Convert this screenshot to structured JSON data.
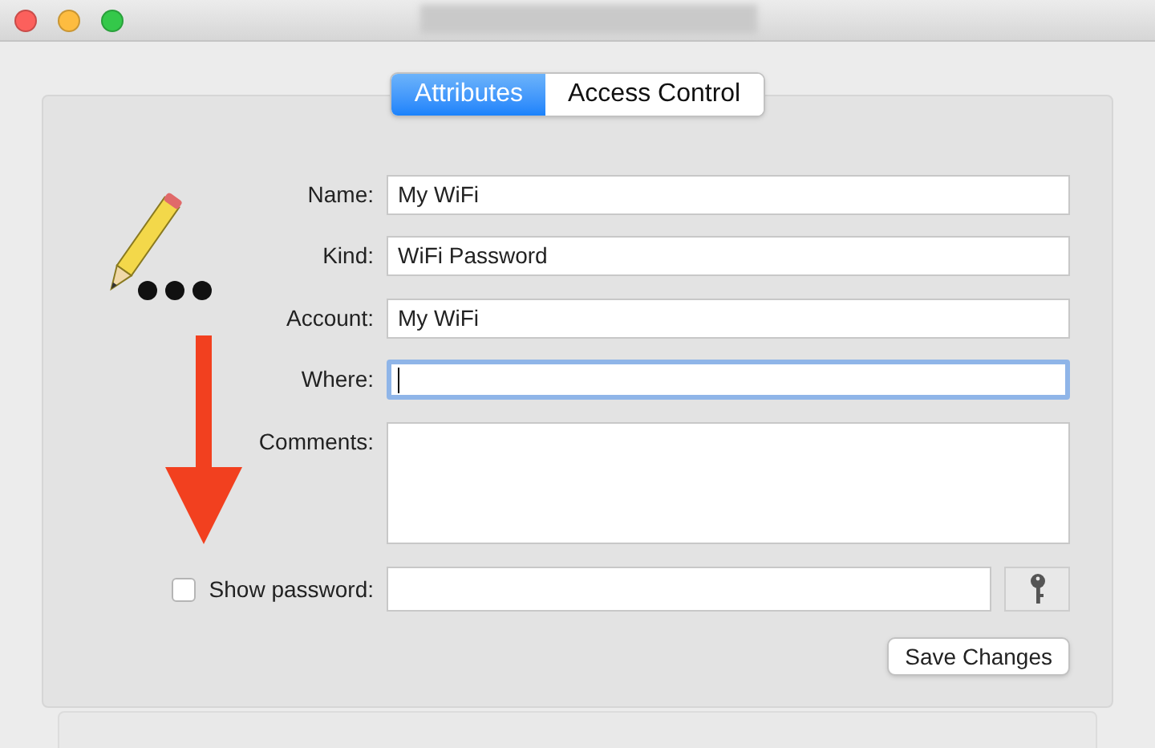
{
  "window": {
    "controls": [
      {
        "kind": "close"
      },
      {
        "kind": "minimize"
      },
      {
        "kind": "zoom"
      }
    ]
  },
  "tabs": [
    {
      "label": "Attributes",
      "selected": true
    },
    {
      "label": "Access Control",
      "selected": false
    }
  ],
  "fields": [
    {
      "label": "Name:",
      "value": "My WiFi",
      "kind": "text",
      "focused": false
    },
    {
      "label": "Kind:",
      "value": "WiFi Password",
      "kind": "text",
      "focused": false
    },
    {
      "label": "Account:",
      "value": "My WiFi",
      "kind": "text",
      "focused": false
    },
    {
      "label": "Where:",
      "kind": "text",
      "focused": true
    },
    {
      "label": "Comments:",
      "kind": "textarea",
      "focused": false
    }
  ],
  "show_password": {
    "label": "Show password:",
    "checked": false
  },
  "save_button": "Save Changes"
}
